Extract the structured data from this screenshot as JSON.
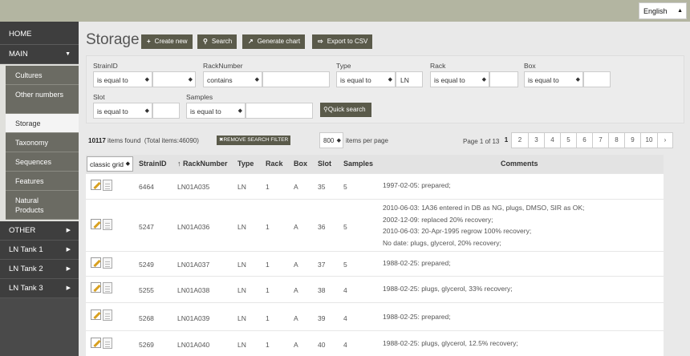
{
  "language": {
    "selected": "English"
  },
  "sidebar": {
    "home": "HOME",
    "main": "MAIN",
    "main_items": [
      {
        "label": "Cultures"
      },
      {
        "label": "Other numbers"
      },
      {
        "label": "Storage"
      },
      {
        "label": "Taxonomy"
      },
      {
        "label": "Sequences"
      },
      {
        "label": "Features"
      },
      {
        "label": "Natural Products"
      }
    ],
    "other": "OTHER",
    "ln_tank_1": "LN Tank 1",
    "ln_tank_2": "LN Tank 2",
    "ln_tank_3": "LN Tank 3"
  },
  "page": {
    "title": "Storage",
    "toolbar": {
      "create": "Create new",
      "search": "Search",
      "chart": "Generate chart",
      "export": "Export to CSV"
    }
  },
  "filter": {
    "strain": {
      "label": "StrainID",
      "op": "is equal to",
      "value": ""
    },
    "rack": {
      "label": "RackNumber",
      "op": "contains",
      "value": ""
    },
    "type": {
      "label": "Type",
      "op": "is equal to",
      "value": "LN"
    },
    "rackf": {
      "label": "Rack",
      "op": "is equal to",
      "value": ""
    },
    "box": {
      "label": "Box",
      "op": "is equal to",
      "value": ""
    },
    "slot": {
      "label": "Slot",
      "op": "is equal to",
      "value": ""
    },
    "samples": {
      "label": "Samples",
      "op": "is equal to",
      "value": ""
    },
    "quick": "Quick search"
  },
  "results": {
    "count": "10117",
    "found_text": "items found",
    "total_text": "(Total items:46090)",
    "remove_filter": "REMOVE SEARCH FILTER",
    "per_page": "800",
    "per_page_text": "items per page",
    "page_info": "Page 1 of 13",
    "pages": [
      "1",
      "2",
      "3",
      "4",
      "5",
      "6",
      "7",
      "8",
      "9",
      "10",
      "›"
    ]
  },
  "grid": {
    "selector": "classic grid",
    "headers": {
      "strain": "StrainID",
      "rack": "↑ RackNumber",
      "type": "Type",
      "rackn": "Rack",
      "box": "Box",
      "slot": "Slot",
      "samples": "Samples",
      "comments": "Comments"
    },
    "rows": [
      {
        "strain": "6464",
        "rack": "LN01A035",
        "type": "LN",
        "rackn": "1",
        "box": "A",
        "slot": "35",
        "samples": "5",
        "comments": [
          "1997-02-05: prepared;"
        ]
      },
      {
        "strain": "5247",
        "rack": "LN01A036",
        "type": "LN",
        "rackn": "1",
        "box": "A",
        "slot": "36",
        "samples": "5",
        "comments": [
          "2010-06-03: 1A36 entered in DB as NG, plugs, DMSO, SIR as OK;",
          "2002-12-09: replaced 20% recovery;",
          "2010-06-03: 20-Apr-1995 regrow 100% recovery;",
          "No date: plugs, glycerol, 20% recovery;"
        ]
      },
      {
        "strain": "5249",
        "rack": "LN01A037",
        "type": "LN",
        "rackn": "1",
        "box": "A",
        "slot": "37",
        "samples": "5",
        "comments": [
          "1988-02-25: prepared;"
        ]
      },
      {
        "strain": "5255",
        "rack": "LN01A038",
        "type": "LN",
        "rackn": "1",
        "box": "A",
        "slot": "38",
        "samples": "4",
        "comments": [
          "1988-02-25: plugs, glycerol, 33% recovery;"
        ]
      },
      {
        "strain": "5268",
        "rack": "LN01A039",
        "type": "LN",
        "rackn": "1",
        "box": "A",
        "slot": "39",
        "samples": "4",
        "comments": [
          "1988-02-25: prepared;"
        ]
      },
      {
        "strain": "5269",
        "rack": "LN01A040",
        "type": "LN",
        "rackn": "1",
        "box": "A",
        "slot": "40",
        "samples": "4",
        "comments": [
          "1988-02-25: plugs, glycerol, 12.5% recovery;"
        ]
      }
    ]
  }
}
